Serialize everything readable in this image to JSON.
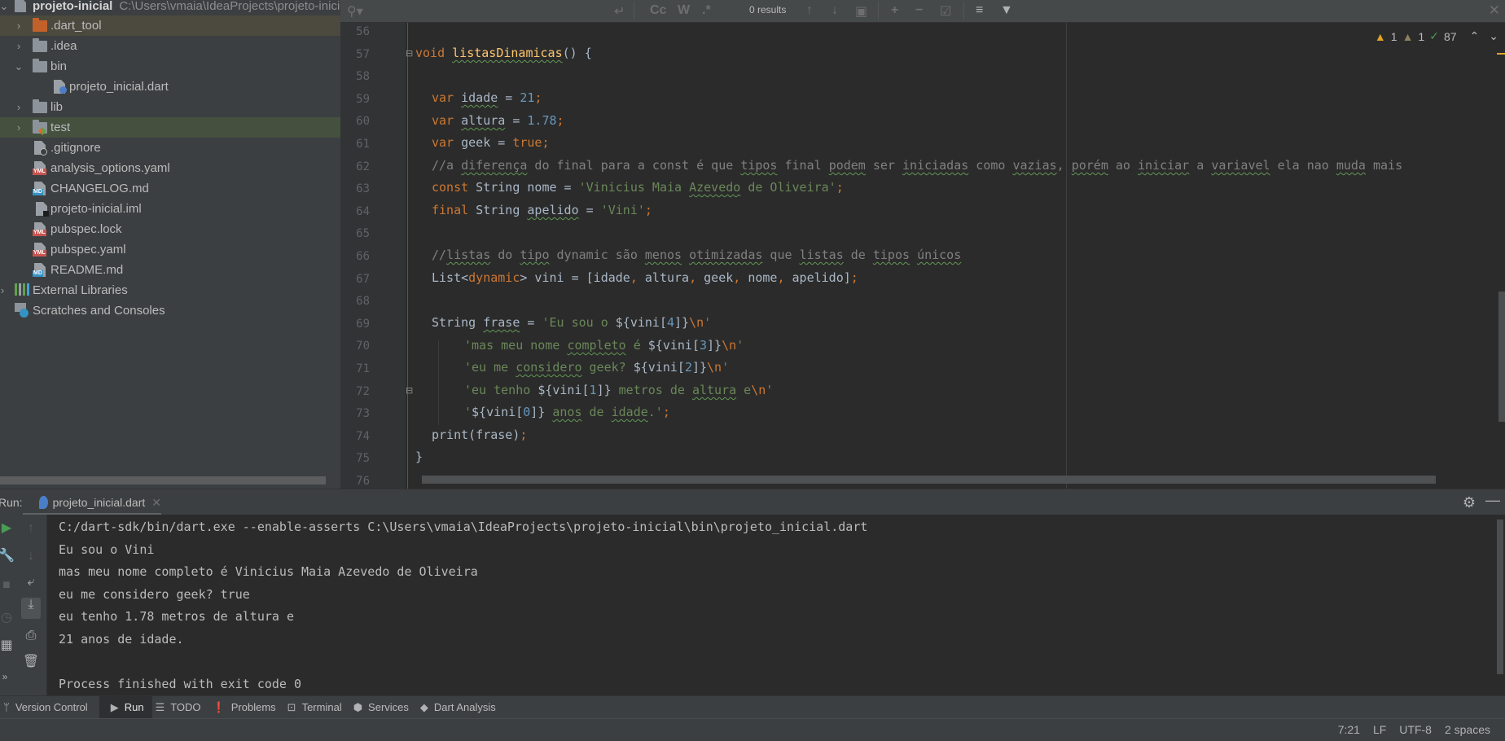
{
  "project_tree": {
    "root": {
      "label": "projeto-inicial",
      "path": "C:\\Users\\vmaia\\IdeaProjects\\projeto-inicial"
    },
    "items": [
      {
        "label": ".dart_tool",
        "type": "folder-excluded",
        "expanded": false
      },
      {
        "label": ".idea",
        "type": "folder",
        "expanded": false
      },
      {
        "label": "bin",
        "type": "folder",
        "expanded": true
      },
      {
        "label": "projeto_inicial.dart",
        "type": "dart-file"
      },
      {
        "label": "lib",
        "type": "folder",
        "expanded": false
      },
      {
        "label": "test",
        "type": "test-folder",
        "expanded": false
      },
      {
        "label": ".gitignore",
        "type": "ignore-file"
      },
      {
        "label": "analysis_options.yaml",
        "type": "yml-file"
      },
      {
        "label": "CHANGELOG.md",
        "type": "md-file"
      },
      {
        "label": "projeto-inicial.iml",
        "type": "iml-file"
      },
      {
        "label": "pubspec.lock",
        "type": "yml-file"
      },
      {
        "label": "pubspec.yaml",
        "type": "yml-file"
      },
      {
        "label": "README.md",
        "type": "md-file"
      },
      {
        "label": "External Libraries",
        "type": "libraries"
      },
      {
        "label": "Scratches and Consoles",
        "type": "scratches"
      }
    ]
  },
  "search_toolbar": {
    "results": "0 results",
    "options": [
      "Cc",
      "W",
      ".*"
    ]
  },
  "inspections": {
    "warnings": "1",
    "weak_warnings": "1",
    "typos": "87"
  },
  "editor": {
    "line_numbers": [
      "56",
      "57",
      "58",
      "59",
      "60",
      "61",
      "62",
      "63",
      "64",
      "65",
      "66",
      "67",
      "68",
      "69",
      "70",
      "71",
      "72",
      "73",
      "74",
      "75",
      "76"
    ],
    "lines": {
      "l57": {
        "kw": "void",
        "name": "listasDinamicas",
        "rest": "() {"
      },
      "l59": {
        "kw": "var",
        "name": "idade",
        "eq": " = ",
        "val": "21",
        "end": ";"
      },
      "l60": {
        "kw": "var",
        "name": "altura",
        "eq": " = ",
        "val": "1.78",
        "end": ";"
      },
      "l61": {
        "kw": "var",
        "name": "geek",
        "eq": " = ",
        "val": "true",
        "end": ";"
      },
      "l62": {
        "c1": "//a ",
        "w1": "diferença",
        "c2": " do final para a const é que ",
        "w2": "tipos",
        "c3": " final ",
        "w3": "podem",
        "c4": " ser ",
        "w4": "iniciadas",
        "c5": " como ",
        "w5": "vazias",
        "c6": ", ",
        "w6": "porém",
        "c7": " ao ",
        "w7": "iniciar",
        "c8": " a ",
        "w8": "variavel",
        "c9": " ela nao ",
        "w9": "muda",
        "c10": " mais"
      },
      "l63": {
        "kw": "const",
        "type": " String nome = ",
        "s1": "'Vinicius Maia ",
        "sw": "Azevedo",
        "s2": " de Oliveira'",
        "end": ";"
      },
      "l64": {
        "kw": "final",
        "type": " String ",
        "name": "apelido",
        "eq": " = ",
        "str": "'Vini'",
        "end": ";"
      },
      "l66": {
        "c1": "//",
        "w1": "listas",
        "c2": " do ",
        "w2": "tipo",
        "c3": " dynamic são ",
        "w3": "menos",
        "c4": " ",
        "w4": "otimizadas",
        "c5": " que ",
        "w5": "listas",
        "c6": " de ",
        "w6": "tipos",
        "c7": " ",
        "w7": "únicos"
      },
      "l67": {
        "t1": "List<",
        "kw": "dynamic",
        "t2": "> vini = [idade",
        "c": ",",
        "t3": " altura",
        "t4": " geek",
        "t5": " nome",
        "t6": " apelido]",
        "end": ";"
      },
      "l69": {
        "t1": "String ",
        "name": "frase",
        "eq": " = ",
        "s1": "'Eu sou o ",
        "i1": "${vini[",
        "n": "4",
        "i2": "]}",
        "esc": "\\n",
        "s2": "'"
      },
      "l70": {
        "s1": "'mas meu nome ",
        "w": "completo",
        "s2": " é ",
        "i1": "${vini[",
        "n": "3",
        "i2": "]}",
        "esc": "\\n",
        "s3": "'"
      },
      "l71": {
        "s1": "'eu me ",
        "w": "considero",
        "s2": " geek? ",
        "i1": "${vini[",
        "n": "2",
        "i2": "]}",
        "esc": "\\n",
        "s3": "'"
      },
      "l72": {
        "s1": "'eu tenho ",
        "i1": "${vini[",
        "n": "1",
        "i2": "]}",
        "s2": " metros de ",
        "w": "altura",
        "s3": " e",
        "esc": "\\n",
        "s4": "'"
      },
      "l73": {
        "s1": "'",
        "i1": "${vini[",
        "n": "0",
        "i2": "]}",
        "s2": " ",
        "w1": "anos",
        "s3": " de ",
        "w2": "idade",
        "s4": ".'",
        "end": ";"
      },
      "l74": {
        "t": "print(frase)",
        "end": ";"
      },
      "l75": {
        "t": "}"
      }
    }
  },
  "run_panel": {
    "label": "Run:",
    "tab_name": "projeto_inicial.dart",
    "console_lines": [
      "C:/dart-sdk/bin/dart.exe --enable-asserts C:\\Users\\vmaia\\IdeaProjects\\projeto-inicial\\bin\\projeto_inicial.dart",
      "Eu sou o Vini",
      "mas meu nome completo é Vinicius Maia Azevedo de Oliveira",
      "eu me considero geek? true",
      "eu tenho 1.78 metros de altura e",
      "21 anos de idade.",
      "",
      "Process finished with exit code 0"
    ]
  },
  "tool_windows": [
    {
      "label": "Version Control",
      "icon": "version-control-icon"
    },
    {
      "label": "Run",
      "icon": "run-icon",
      "active": true
    },
    {
      "label": "TODO",
      "icon": "todo-icon"
    },
    {
      "label": "Problems",
      "icon": "problems-icon"
    },
    {
      "label": "Terminal",
      "icon": "terminal-icon"
    },
    {
      "label": "Services",
      "icon": "services-icon"
    },
    {
      "label": "Dart Analysis",
      "icon": "dart-analysis-icon"
    }
  ],
  "status_bar": {
    "position": "7:21",
    "line_separator": "LF",
    "encoding": "UTF-8",
    "indent": "2 spaces"
  }
}
